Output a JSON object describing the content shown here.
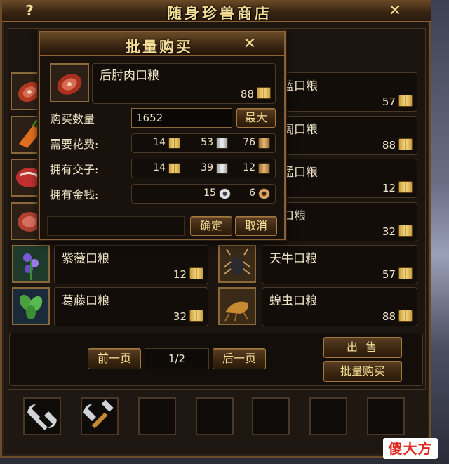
{
  "window": {
    "title": "随身珍兽商店",
    "help_label": "?",
    "close_label": "✕"
  },
  "items": [
    {
      "name": "蓝口粮",
      "price": "57",
      "icon": "meat-icon"
    },
    {
      "name": "阔口粮",
      "price": "88",
      "icon": "carrot-icon"
    },
    {
      "name": "猛口粮",
      "price": "12",
      "icon": "steak-icon"
    },
    {
      "name": "口粮",
      "price": "32",
      "icon": "ham-icon"
    },
    {
      "name": "紫薇口粮",
      "price": "12",
      "icon": "purple-flower-icon"
    },
    {
      "name": "天牛口粮",
      "price": "57",
      "icon": "beetle-icon"
    },
    {
      "name": "葛藤口粮",
      "price": "32",
      "icon": "leaf-icon"
    },
    {
      "name": "蝗虫口粮",
      "price": "88",
      "icon": "locust-icon"
    }
  ],
  "pagination": {
    "prev_label": "前一页",
    "page_indicator": "1/2",
    "next_label": "后一页"
  },
  "actions": {
    "sell_label": "出 售",
    "bulk_buy_label": "批量购买"
  },
  "toolbar": {
    "slots": [
      "wrench-icon",
      "tools-icon",
      "",
      "",
      "",
      "",
      ""
    ]
  },
  "dialog": {
    "title": "批量购买",
    "close_label": "✕",
    "item_name": "后肘肉口粮",
    "item_price": "88",
    "qty_label": "购买数量",
    "qty_value": "1652",
    "max_label": "最大",
    "cost_label": "需要花费:",
    "cost": {
      "gold": "14",
      "silver": "53",
      "bronze": "76"
    },
    "jiaozi_label": "拥有交子:",
    "jiaozi": {
      "gold": "14",
      "silver": "39",
      "bronze": "12"
    },
    "money_label": "拥有金钱:",
    "money": {
      "silver": "15",
      "bronze": "6"
    },
    "confirm_label": "确定",
    "cancel_label": "取消"
  },
  "watermark": "傻大方",
  "colors": {
    "frame": "#8a6234",
    "text": "#f0e4c8",
    "title": "#f4dd96",
    "watermark": "#e0281e"
  }
}
